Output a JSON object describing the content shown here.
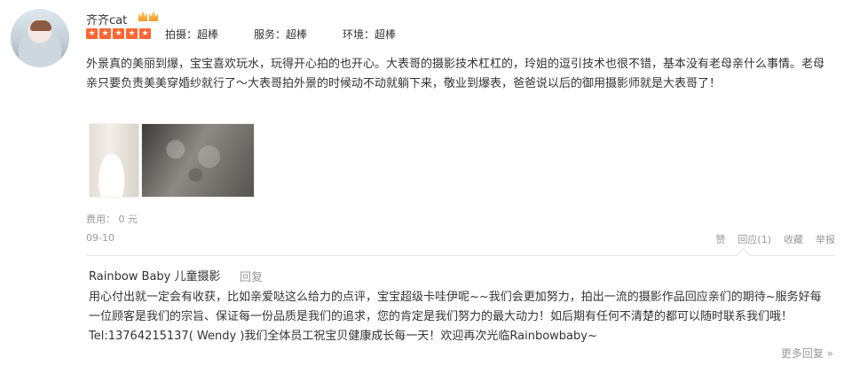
{
  "user": {
    "name": "齐齐cat"
  },
  "ratings": {
    "stars": 5,
    "items": [
      {
        "label": "拍摄：超棒"
      },
      {
        "label": "服务：超棒"
      },
      {
        "label": "环境：超棒"
      }
    ]
  },
  "review": {
    "text": "外景真的美丽到爆，宝宝喜欢玩水，玩得开心拍的也开心。大表哥的摄影技术杠杠的，玲姐的逗引技术也很不错，基本没有老母亲什么事情。老母亲只要负责美美穿婚纱就行了～大表哥拍外景的时候动不动就躺下来，敬业到爆表，爸爸说以后的御用摄影师就是大表哥了！"
  },
  "fee": "费用： 0 元",
  "date": "09-10",
  "actions": {
    "like": "赞",
    "reply": "回应(1)",
    "collect": "收藏",
    "report": "举报"
  },
  "merchant_reply": {
    "name": "Rainbow Baby 儿童摄影",
    "reply_label": "回复",
    "text": "用心付出就一定会有收获，比如亲爱哒这么给力的点评，宝宝超级卡哇伊呢~~我们会更加努力，拍出一流的摄影作品回应亲们的期待~服务好每一位顾客是我们的宗旨、保证每一份品质是我们的追求，您的肯定是我们努力的最大动力！如后期有任何不清楚的都可以随时联系我们哦！Tel:13764215137( Wendy )我们全体员工祝宝贝健康成长每一天！欢迎再次光临Rainbowbaby~"
  },
  "more_replies": "更多回复 »",
  "colors": {
    "star": "#ff6633",
    "muted": "#999999",
    "text": "#333333"
  }
}
